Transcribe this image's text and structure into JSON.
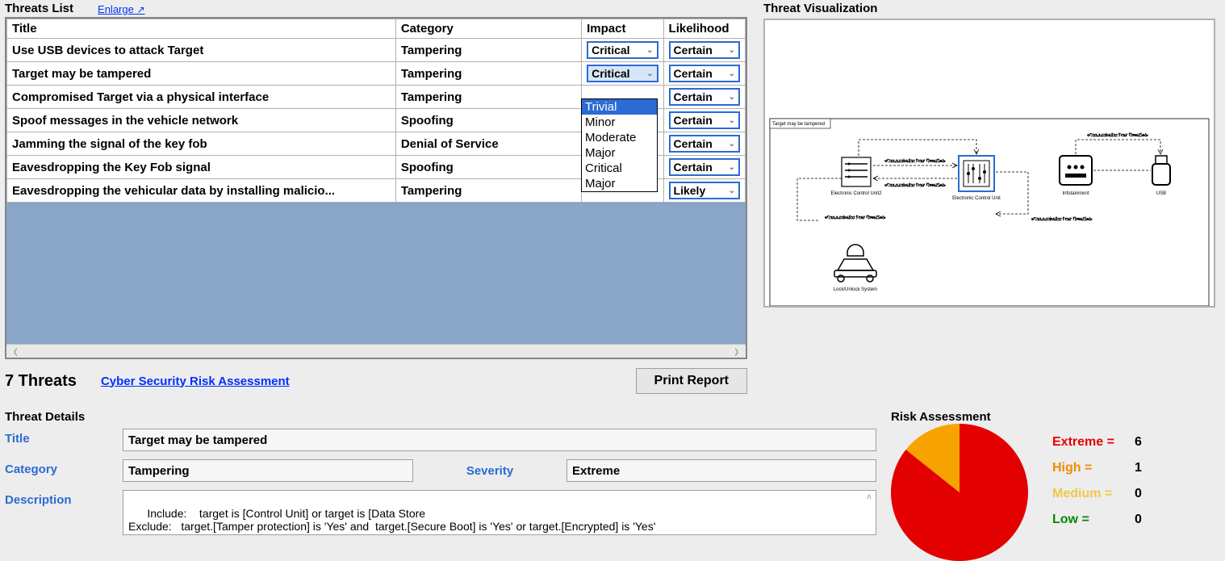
{
  "threats_list": {
    "title": "Threats List",
    "enlarge_label": "Enlarge",
    "enlarge_icon": "↗",
    "columns": {
      "title": "Title",
      "category": "Category",
      "impact": "Impact",
      "likelihood": "Likelihood"
    },
    "rows": [
      {
        "title": "Use USB devices to attack Target",
        "category": "Tampering",
        "impact": "Critical",
        "likelihood": "Certain"
      },
      {
        "title": "Target may be tampered",
        "category": "Tampering",
        "impact": "Critical",
        "likelihood": "Certain"
      },
      {
        "title": "Compromised  Target via a physical interface",
        "category": "Tampering",
        "impact": "",
        "likelihood": "Certain"
      },
      {
        "title": "Spoof messages in the vehicle network",
        "category": "Spoofing",
        "impact": "",
        "likelihood": "Certain"
      },
      {
        "title": "Jamming the signal of the key fob",
        "category": "Denial of Service",
        "impact": "",
        "likelihood": "Certain"
      },
      {
        "title": "Eavesdropping the Key Fob signal",
        "category": "Spoofing",
        "impact": "",
        "likelihood": "Certain"
      },
      {
        "title": "Eavesdropping the vehicular data by installing malicio...",
        "category": "Tampering",
        "impact": "",
        "likelihood": "Likely"
      }
    ],
    "dropdown_options": [
      "Trivial",
      "Minor",
      "Moderate",
      "Major",
      "Critical",
      "Major"
    ],
    "dropdown_selected": "Trivial"
  },
  "count_row": {
    "count_text": "7 Threats",
    "cyber_link": "Cyber Security Risk Assessment",
    "print_label": "Print Report"
  },
  "viz": {
    "title": "Threat Visualization",
    "header": "Target may be tampered",
    "flow_label": "«Communication Flow ThreatSet»",
    "nodes": {
      "ecu2": "Electronic Control Unit2",
      "ecu": "Electronic Control Unit",
      "infotainment": "Infotainment",
      "usb": "USB",
      "lock": "Lock/Unlock System"
    }
  },
  "details": {
    "title": "Threat Details",
    "labels": {
      "title": "Title",
      "category": "Category",
      "severity": "Severity",
      "description": "Description"
    },
    "values": {
      "title": "Target may be tampered",
      "category": "Tampering",
      "severity": "Extreme",
      "description": "Include:    target is [Control Unit] or target is [Data Store\nExclude:   target.[Tamper protection] is 'Yes' and  target.[Secure Boot] is 'Yes' or target.[Encrypted] is 'Yes'"
    }
  },
  "risk": {
    "title": "Risk Assessment",
    "legend": {
      "extreme_label": "Extreme  =",
      "extreme_value": "6",
      "high_label": "High  =",
      "high_value": "1",
      "medium_label": "Medium  =",
      "medium_value": "0",
      "low_label": "Low  =",
      "low_value": "0"
    }
  },
  "chart_data": {
    "type": "pie",
    "title": "Risk Assessment",
    "series": [
      {
        "name": "Extreme",
        "value": 6,
        "color": "#e30000"
      },
      {
        "name": "High",
        "value": 1,
        "color": "#f7a400"
      },
      {
        "name": "Medium",
        "value": 0,
        "color": "#f2c744"
      },
      {
        "name": "Low",
        "value": 0,
        "color": "#008a00"
      }
    ]
  }
}
